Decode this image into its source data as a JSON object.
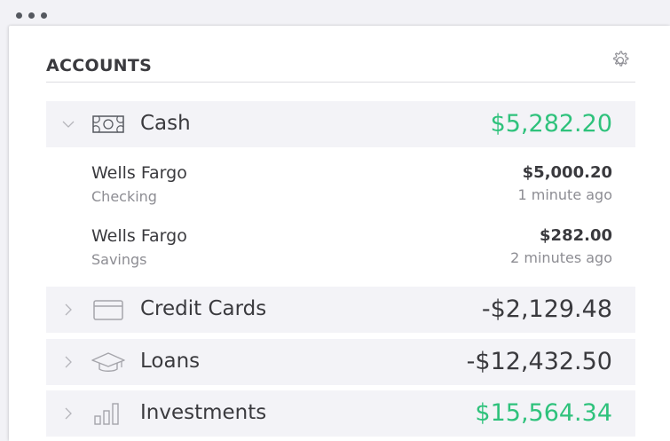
{
  "window": {
    "controls": [
      "dot",
      "dot",
      "dot"
    ]
  },
  "header": {
    "title": "ACCOUNTS",
    "settings_icon": "gear-icon"
  },
  "groups": [
    {
      "label": "Cash",
      "amount": "$5,282.20",
      "expanded": true,
      "icon": "cash-icon",
      "accounts": [
        {
          "name": "Wells Fargo",
          "type": "Checking",
          "balance": "$5,000.20",
          "updated": "1 minute ago"
        },
        {
          "name": "Wells Fargo",
          "type": "Savings",
          "balance": "$282.00",
          "updated": "2 minutes ago"
        }
      ]
    },
    {
      "label": "Credit Cards",
      "amount": "-$2,129.48",
      "expanded": false,
      "icon": "credit-card-icon"
    },
    {
      "label": "Loans",
      "amount": "-$12,432.50",
      "expanded": false,
      "icon": "graduation-cap-icon"
    },
    {
      "label": "Investments",
      "amount": "$15,564.34",
      "expanded": false,
      "icon": "bar-chart-icon"
    }
  ],
  "colors": {
    "positive": "#2fc27c",
    "text": "#3a3a3e",
    "muted": "#8d8d93",
    "row_bg": "#f3f3f7"
  }
}
